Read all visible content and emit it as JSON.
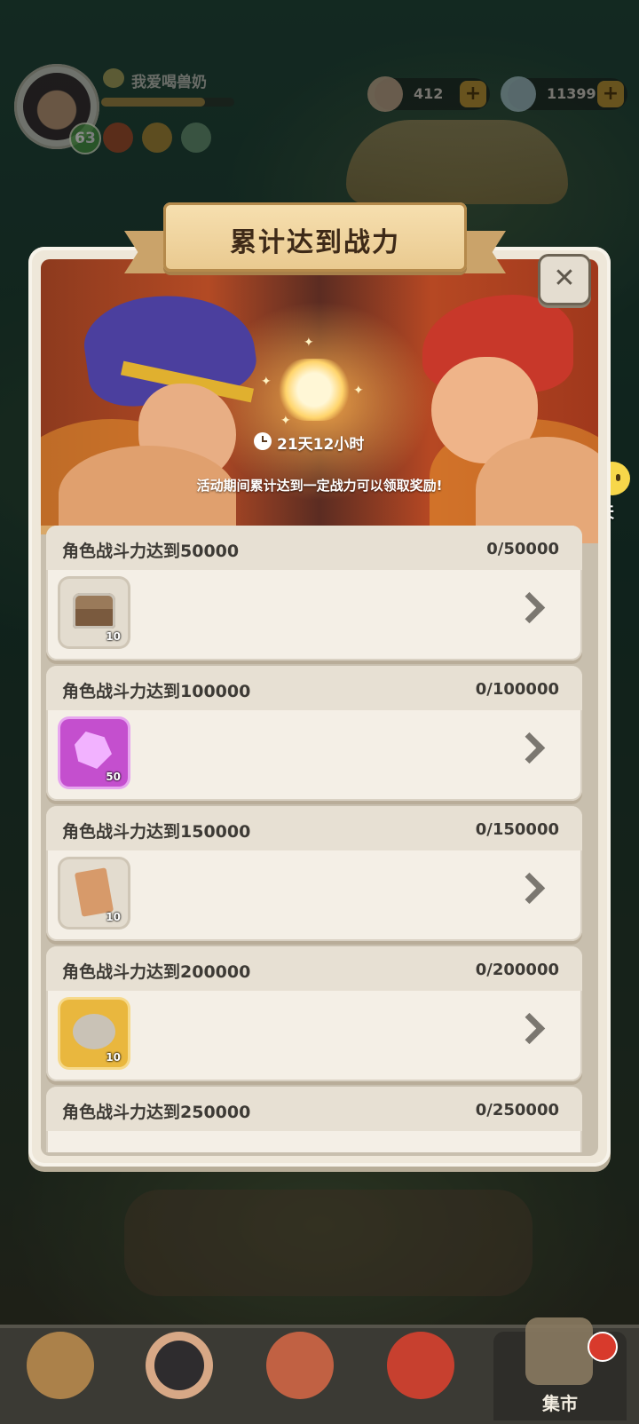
{
  "hud": {
    "player_name": "我爱喝兽奶",
    "level": "63",
    "currency1": "412",
    "currency2": "11399",
    "add_label": "+"
  },
  "chat": {
    "label": "聊天",
    "dots": "..."
  },
  "modal": {
    "title": "累计达到战力",
    "timer": "21天12小时",
    "description": "活动期间累计达到一定战力可以领取奖励!",
    "close_label": "✕",
    "tasks": [
      {
        "title": "角色战斗力达到50000",
        "progress": "0/50000",
        "reward_icon": "treasure-chest-icon",
        "reward_qty": "10"
      },
      {
        "title": "角色战斗力达到100000",
        "progress": "0/100000",
        "reward_icon": "purple-crystal-icon",
        "reward_qty": "50"
      },
      {
        "title": "角色战斗力达到150000",
        "progress": "0/150000",
        "reward_icon": "paw-scroll-icon",
        "reward_qty": "10"
      },
      {
        "title": "角色战斗力达到200000",
        "progress": "0/200000",
        "reward_icon": "skull-token-icon",
        "reward_qty": "10"
      },
      {
        "title": "角色战斗力达到250000",
        "progress": "0/250000",
        "reward_icon": "",
        "reward_qty": ""
      }
    ]
  },
  "nav": {
    "items": [
      {
        "icon": "beast-icon"
      },
      {
        "icon": "hero-icon"
      },
      {
        "icon": "totem-icon"
      },
      {
        "icon": "dino-icon"
      },
      {
        "icon": "market-icon",
        "label": "集市"
      }
    ]
  }
}
